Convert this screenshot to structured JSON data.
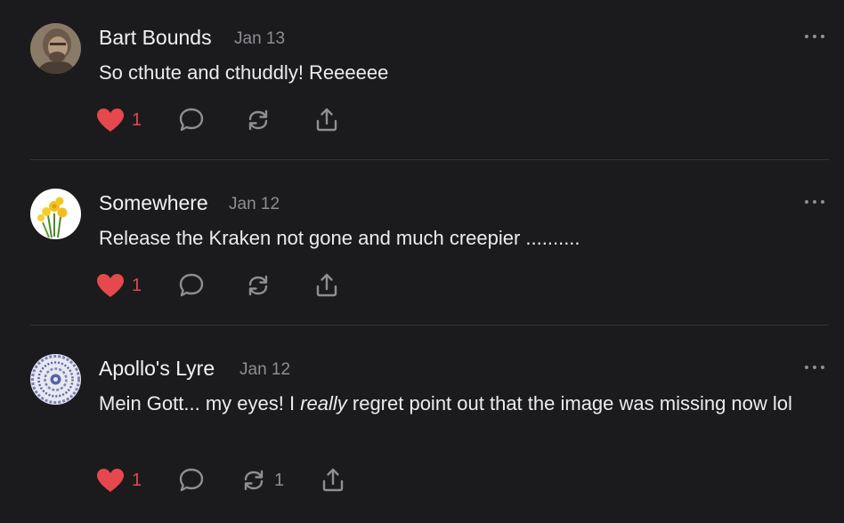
{
  "comments": [
    {
      "author": "Bart Bounds",
      "date": "Jan 13",
      "body": "So cthute and cthuddly! Reeeeee",
      "like_count": "1",
      "restack_count": ""
    },
    {
      "author": "Somewhere",
      "date": "Jan 12",
      "body": "Release the Kraken not gone and much creepier ..........",
      "like_count": "1",
      "restack_count": ""
    },
    {
      "author": "Apollo's Lyre",
      "date": "Jan 12",
      "body_before": "Mein Gott... my eyes! I ",
      "body_emphasis": "really",
      "body_after": " regret point out that the image was missing now lol",
      "like_count": "1",
      "restack_count": "1"
    }
  ],
  "colors": {
    "background": "#1b1b1d",
    "like_red": "#e5484d",
    "muted": "#8e8e93",
    "divider": "#333336"
  },
  "icons": [
    "heart-icon",
    "comment-icon",
    "restack-icon",
    "share-icon",
    "more-icon"
  ]
}
